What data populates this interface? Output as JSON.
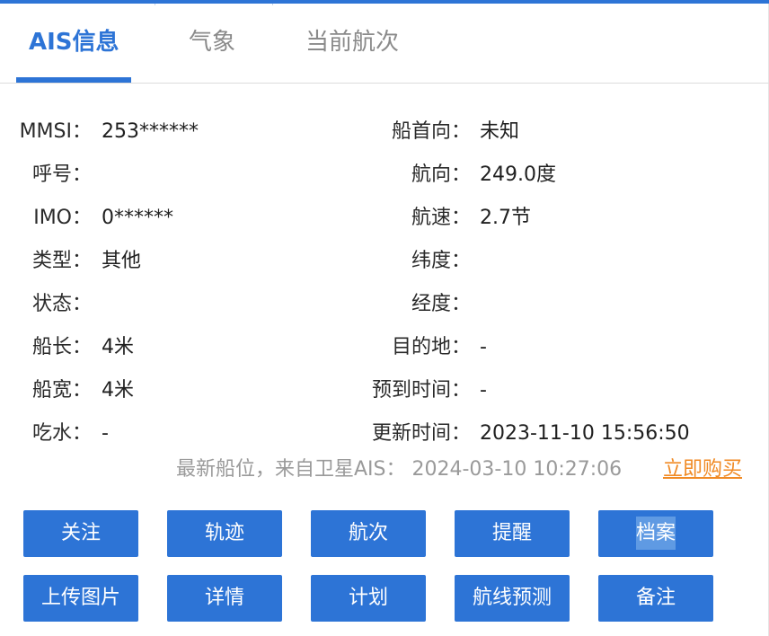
{
  "tabs": [
    {
      "label": "AIS信息",
      "active": true
    },
    {
      "label": "气象",
      "active": false
    },
    {
      "label": "当前航次",
      "active": false
    }
  ],
  "ais": {
    "left": [
      {
        "label": "MMSI：",
        "value": "253******"
      },
      {
        "label": "呼号：",
        "value": ""
      },
      {
        "label": "IMO：",
        "value": "0******"
      },
      {
        "label": "类型：",
        "value": "其他"
      },
      {
        "label": "状态：",
        "value": ""
      },
      {
        "label": "船长：",
        "value": "4米"
      },
      {
        "label": "船宽：",
        "value": "4米"
      },
      {
        "label": "吃水：",
        "value": "-"
      }
    ],
    "right": [
      {
        "label": "船首向：",
        "value": "未知"
      },
      {
        "label": "航向：",
        "value": "249.0度"
      },
      {
        "label": "航速：",
        "value": "2.7节"
      },
      {
        "label": "纬度：",
        "value": ""
      },
      {
        "label": "经度：",
        "value": ""
      },
      {
        "label": "目的地：",
        "value": "-"
      },
      {
        "label": "预到时间：",
        "value": "-"
      },
      {
        "label": "更新时间：",
        "value": "2023-11-10 15:56:50"
      }
    ]
  },
  "latest_position": {
    "text": "最新船位，来自卫星AIS：  2024-03-10 10:27:06",
    "buy_link": "立即购买"
  },
  "buttons": {
    "row1": [
      "关注",
      "轨迹",
      "航次",
      "提醒",
      "档案"
    ],
    "row2": [
      "上传图片",
      "详情",
      "计划",
      "航线预测",
      "备注"
    ]
  },
  "colors": {
    "accent": "#2d74d6",
    "link": "#f08a24",
    "muted": "#9a9a9a"
  }
}
